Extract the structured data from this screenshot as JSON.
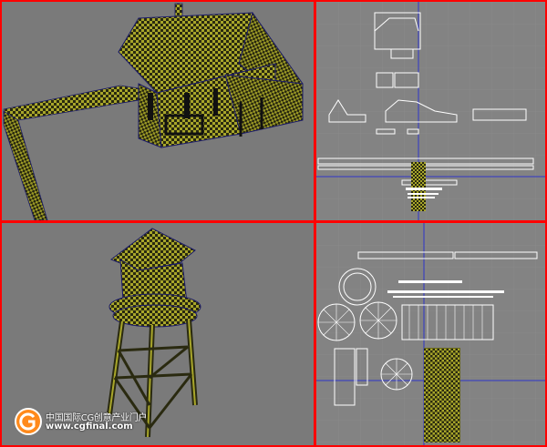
{
  "watermark": {
    "line1": "中国国际CG创意产业门户",
    "line2": "www.cgfinal.com"
  },
  "colors": {
    "viewport_border": "#ff0000",
    "viewport_bg": "#7b7b7b",
    "checker_dark": "#2a2a10",
    "checker_light": "#a8a62a",
    "wire": "#ffffff",
    "axis": "#2f36c8",
    "logo_orange": "#ff8a1c"
  },
  "viewports": [
    {
      "id": "perspective-house"
    },
    {
      "id": "uv-house"
    },
    {
      "id": "perspective-tower"
    },
    {
      "id": "uv-tower"
    }
  ]
}
